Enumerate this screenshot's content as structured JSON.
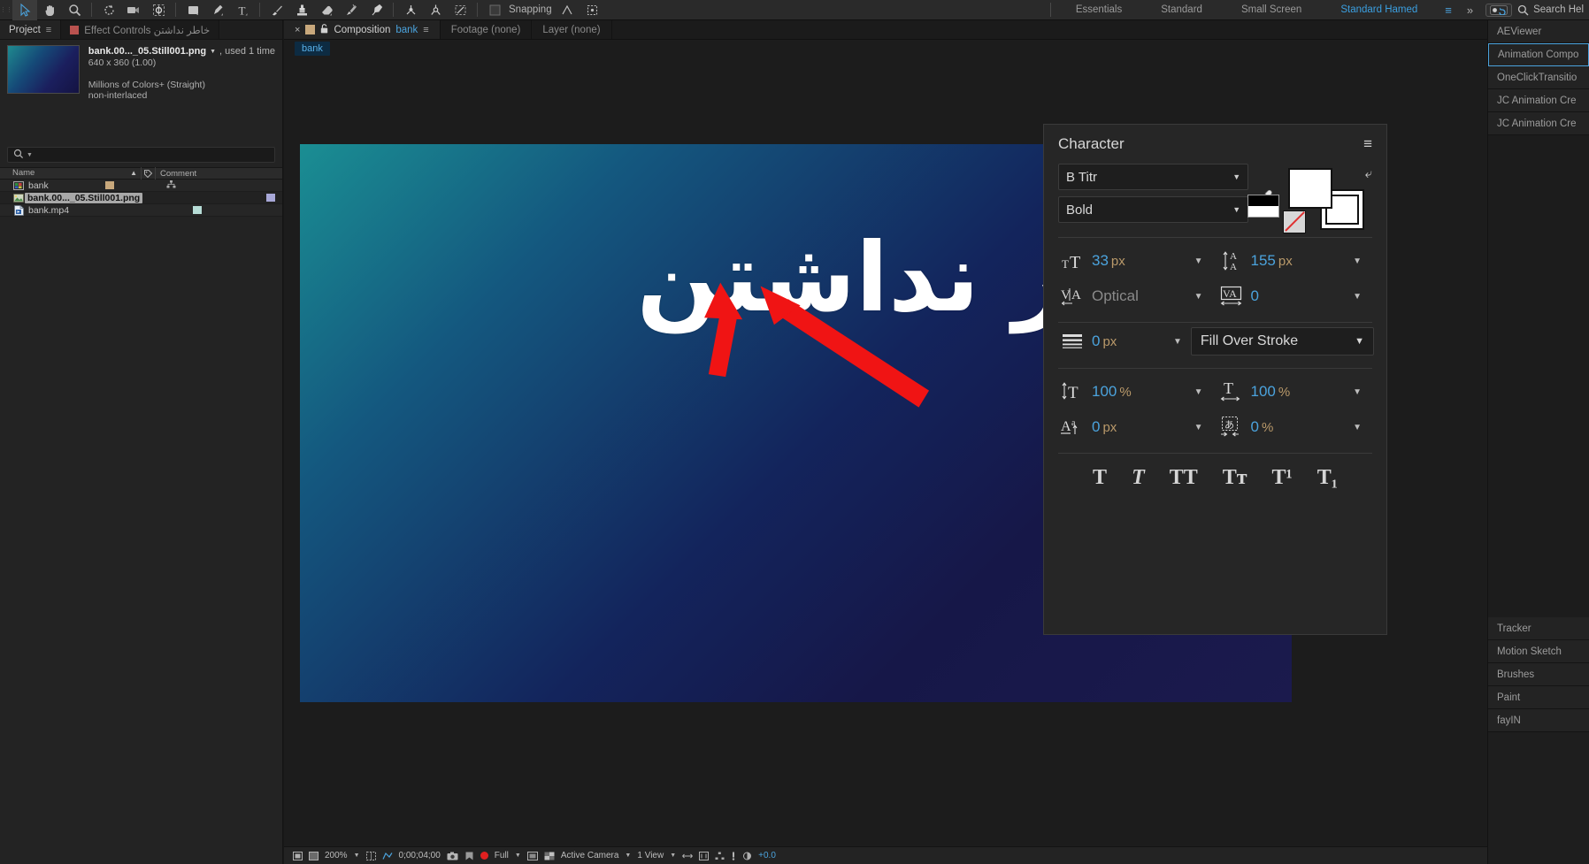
{
  "toolbar": {
    "tools": [
      {
        "name": "selection-tool",
        "glyph": "arrow"
      },
      {
        "name": "hand-tool",
        "glyph": "hand"
      },
      {
        "name": "zoom-tool",
        "glyph": "magnifier"
      },
      {
        "name": "rotation-tool",
        "glyph": "rotate"
      },
      {
        "name": "camera-tool",
        "glyph": "camera"
      },
      {
        "name": "pan-behind-tool",
        "glyph": "anchor"
      },
      {
        "name": "shape-tool",
        "glyph": "rect"
      },
      {
        "name": "pen-tool",
        "glyph": "pen"
      },
      {
        "name": "type-tool",
        "glyph": "type"
      },
      {
        "name": "brush-tool",
        "glyph": "brush"
      },
      {
        "name": "clone-stamp-tool",
        "glyph": "stamp"
      },
      {
        "name": "eraser-tool",
        "glyph": "eraser"
      },
      {
        "name": "roto-brush-tool",
        "glyph": "rotobrush"
      },
      {
        "name": "puppet-pin-tool",
        "glyph": "pin"
      }
    ],
    "axis_tools": [
      {
        "name": "local-axis-mode"
      },
      {
        "name": "world-axis-mode"
      },
      {
        "name": "view-axis-mode"
      }
    ],
    "snapping_label": "Snapping",
    "search_label": "Search Hel"
  },
  "workspaces": {
    "items": [
      {
        "label": "Essentials",
        "selected": false
      },
      {
        "label": "Standard",
        "selected": false
      },
      {
        "label": "Small Screen",
        "selected": false
      },
      {
        "label": "Standard Hamed",
        "selected": true
      }
    ],
    "menu_glyph": "≡",
    "overflow_glyph": "»"
  },
  "project_panel": {
    "tabs": [
      {
        "label": "Project",
        "active": true,
        "has_swatch": false,
        "has_menu": true
      },
      {
        "label": "Effect Controls خاطر نداشتن",
        "active": false,
        "has_swatch": true,
        "has_menu": false
      }
    ],
    "selected_item": {
      "filename": "bank.00..._05.Still001.png",
      "used": ", used 1 time",
      "dimensions": "640 x 360 (1.00)",
      "color_depth": "Millions of Colors+ (Straight)",
      "interlace": "non-interlaced"
    },
    "search_placeholder": "",
    "search_value": "",
    "columns": {
      "name": "Name",
      "tag": "tag-icon",
      "comment": "Comment"
    },
    "files": [
      {
        "name": "bank",
        "type": "composition",
        "label_color": "#c8a87c",
        "selected": false,
        "has_tree": true
      },
      {
        "name": "bank.00..._05.Still001.png",
        "type": "image",
        "label_color": "#a8a8d8",
        "selected": true,
        "has_tree": false
      },
      {
        "name": "bank.mp4",
        "type": "video",
        "label_color": "#b6dcd6",
        "selected": false,
        "has_tree": false
      }
    ]
  },
  "comp_panel": {
    "tabs": [
      {
        "label": "Composition",
        "name": "bank",
        "active": true
      },
      {
        "label": "Footage (none)",
        "name": "",
        "active": false
      },
      {
        "label": "Layer (none)",
        "name": "",
        "active": false
      }
    ],
    "breadcrumb": "bank",
    "canvas_text": "خاطر نداشتن",
    "gradient": {
      "from": "#1a8e93",
      "mid": "#13245c",
      "to": "#1b1a4d"
    },
    "annotation_color": "#f01414",
    "bottom_bar": {
      "zoom": "200%",
      "timecode": "0;00;04;00",
      "resolution": "Full",
      "view": "Active Camera",
      "magnification": "1 View"
    }
  },
  "character_panel": {
    "title": "Character",
    "font_family": "B Titr",
    "font_style": "Bold",
    "font_size": {
      "value": "33",
      "unit": "px",
      "icon": "font-size-icon"
    },
    "leading": {
      "value": "155",
      "unit": "px",
      "icon": "leading-icon"
    },
    "kerning": {
      "value": "Optical",
      "unit": "",
      "icon": "kerning-icon",
      "dim": true
    },
    "tracking": {
      "value": "0",
      "unit": "",
      "icon": "tracking-icon"
    },
    "stroke_width": {
      "value": "0",
      "unit": "px",
      "icon": "stroke-width-icon"
    },
    "fill_stroke_order": "Fill Over Stroke",
    "vertical_scale": {
      "value": "100",
      "unit": "%",
      "icon": "vertical-scale-icon"
    },
    "horizontal_scale": {
      "value": "100",
      "unit": "%",
      "icon": "horizontal-scale-icon"
    },
    "baseline_shift": {
      "value": "0",
      "unit": "px",
      "icon": "baseline-shift-icon"
    },
    "tsume": {
      "value": "0",
      "unit": "%",
      "icon": "tsume-icon"
    },
    "style_buttons": [
      {
        "name": "faux-bold-button",
        "glyph": "T"
      },
      {
        "name": "faux-italic-button",
        "glyph": "T"
      },
      {
        "name": "all-caps-button",
        "glyph": "TT"
      },
      {
        "name": "small-caps-button",
        "glyph": "Tт"
      },
      {
        "name": "superscript-button",
        "glyph": "T¹"
      },
      {
        "name": "subscript-button",
        "glyph": "T₁"
      }
    ],
    "menu_glyph": "≡"
  },
  "right_dock": {
    "top_items": [
      {
        "label": "AEViewer",
        "selected": false
      },
      {
        "label": "Animation Compo",
        "selected": true
      },
      {
        "label": "OneClickTransitio",
        "selected": false
      },
      {
        "label": "JC Animation Cre",
        "selected": false
      },
      {
        "label": "JC Animation Cre",
        "selected": false
      }
    ],
    "bottom_items": [
      {
        "label": "Tracker",
        "selected": false
      },
      {
        "label": "Motion Sketch",
        "selected": false
      },
      {
        "label": "Brushes",
        "selected": false
      },
      {
        "label": "Paint",
        "selected": false
      },
      {
        "label": "fayIN",
        "selected": false
      }
    ]
  }
}
